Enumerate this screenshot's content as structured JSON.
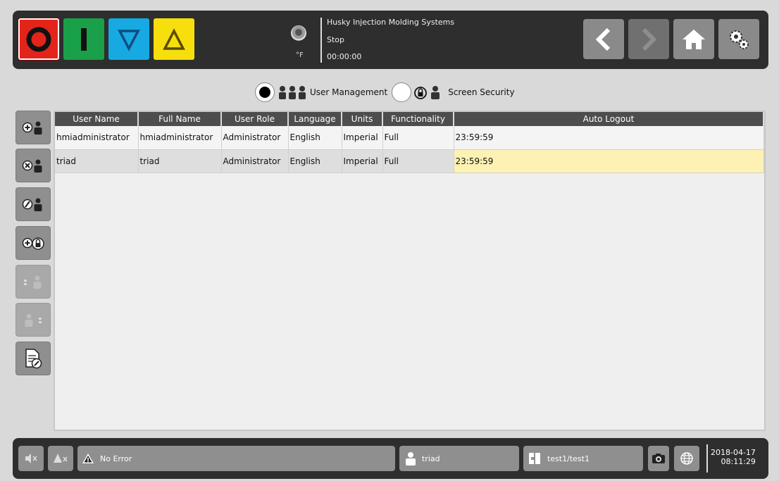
{
  "header": {
    "system_name": "Husky Injection Molding Systems",
    "status": "Stop",
    "cycle_time": "00:00:00",
    "temp_unit": "°F",
    "colors": {
      "red": "#e3241b",
      "green": "#1aa049",
      "blue": "#17a9e1",
      "yellow": "#f6df0c"
    }
  },
  "modes": {
    "user_management": "User Management",
    "screen_security": "Screen Security",
    "selected": "user_management"
  },
  "table": {
    "columns": [
      "User Name",
      "Full Name",
      "User Role",
      "Language",
      "Units",
      "Functionality",
      "Auto Logout"
    ],
    "rows": [
      [
        "hmiadministrator",
        "hmiadministrator",
        "Administrator",
        "English",
        "Imperial",
        "Full",
        "23:59:59"
      ],
      [
        "triad",
        "triad",
        "Administrator",
        "English",
        "Imperial",
        "Full",
        "23:59:59"
      ]
    ]
  },
  "sidebar": {
    "buttons": [
      "add-user",
      "delete-user",
      "edit-user",
      "add-security",
      "move-left",
      "move-right",
      "report-edit"
    ]
  },
  "footer": {
    "error_text": "No Error",
    "user": "triad",
    "mold": "test1/test1",
    "date": "2018-04-17",
    "time": "08:11:29"
  }
}
